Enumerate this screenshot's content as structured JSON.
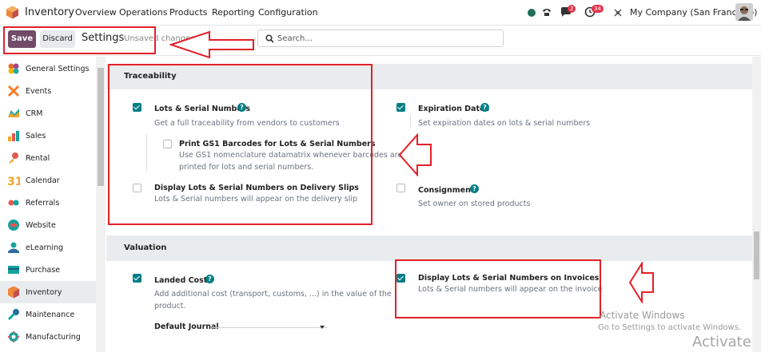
{
  "navbar": {
    "app_name": "Inventory",
    "menu": [
      "Overview",
      "Operations",
      "Products",
      "Reporting",
      "Configuration"
    ],
    "chat_badge": "2",
    "activity_badge": "34",
    "company": "My Company (San Francisco)"
  },
  "control": {
    "save_label": "Save",
    "discard_label": "Discard",
    "title": "Settings",
    "unsaved": "Unsaved changes",
    "search_placeholder": "Search..."
  },
  "sidebar": {
    "items": [
      {
        "label": "General Settings",
        "icon": "odoo-settings-icon"
      },
      {
        "label": "Events",
        "icon": "events-icon"
      },
      {
        "label": "CRM",
        "icon": "crm-icon"
      },
      {
        "label": "Sales",
        "icon": "sales-icon"
      },
      {
        "label": "Rental",
        "icon": "rental-icon"
      },
      {
        "label": "Calendar",
        "icon": "calendar-icon"
      },
      {
        "label": "Referrals",
        "icon": "referrals-icon"
      },
      {
        "label": "Website",
        "icon": "website-icon"
      },
      {
        "label": "eLearning",
        "icon": "elearning-icon"
      },
      {
        "label": "Purchase",
        "icon": "purchase-icon"
      },
      {
        "label": "Inventory",
        "icon": "inventory-icon"
      },
      {
        "label": "Maintenance",
        "icon": "maintenance-icon"
      },
      {
        "label": "Manufacturing",
        "icon": "manufacturing-icon"
      }
    ],
    "active": "Inventory"
  },
  "traceability": {
    "title": "Traceability",
    "lots": {
      "title": "Lots & Serial Numbers",
      "desc": "Get a full traceability from vendors to customers",
      "checked": true
    },
    "gs1": {
      "title": "Print GS1 Barcodes for Lots & Serial Numbers",
      "desc1": "Use GS1 nomenclature datamatrix whenever barcodes are",
      "desc2": "printed for lots and serial numbers.",
      "checked": false
    },
    "delivery": {
      "title": "Display Lots & Serial Numbers on Delivery Slips",
      "desc": "Lots & Serial numbers will appear on the delivery slip",
      "checked": false
    },
    "expiration": {
      "title": "Expiration Dates",
      "desc": "Set expiration dates on lots & serial numbers",
      "checked": true
    },
    "consignment": {
      "title": "Consignment",
      "desc": "Set owner on stored products",
      "checked": false
    }
  },
  "valuation": {
    "title": "Valuation",
    "landed": {
      "title": "Landed Costs",
      "desc1": "Add additional cost (transport, customs, ...) in the value of the",
      "desc2": "product.",
      "checked": true,
      "journal_label": "Default Journal"
    },
    "invoices": {
      "title": "Display Lots & Serial Numbers on Invoices",
      "desc": "Lots & Serial numbers will appear on the invoice",
      "checked": true
    }
  },
  "watermark": {
    "line1": "Activate Windows",
    "line2": "Go to Settings to activate Windows.",
    "line3": "Activate"
  },
  "colors": {
    "brand": "#714b67",
    "accent": "#017e84",
    "annotation": "#e32028"
  }
}
